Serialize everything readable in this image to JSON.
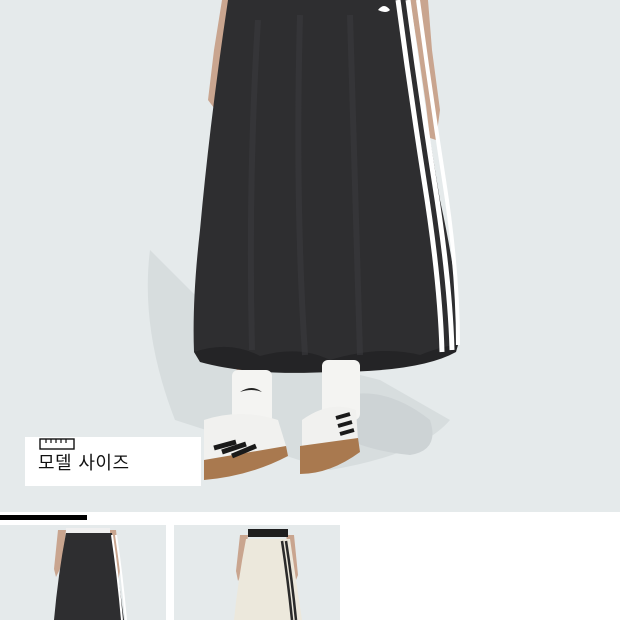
{
  "gallery": {
    "size_badge_label": "모델 사이즈",
    "ruler_icon": "ruler-icon",
    "progress_fraction": 0.14,
    "thumbnails": [
      {
        "name": "thumb-black-skirt",
        "color": "#2e2e30"
      },
      {
        "name": "thumb-ivory-skirt",
        "color": "#ece8dc"
      }
    ]
  },
  "colors": {
    "background": "#e5eaeb",
    "skirt": "#2e2e30",
    "stripe": "#ffffff"
  }
}
